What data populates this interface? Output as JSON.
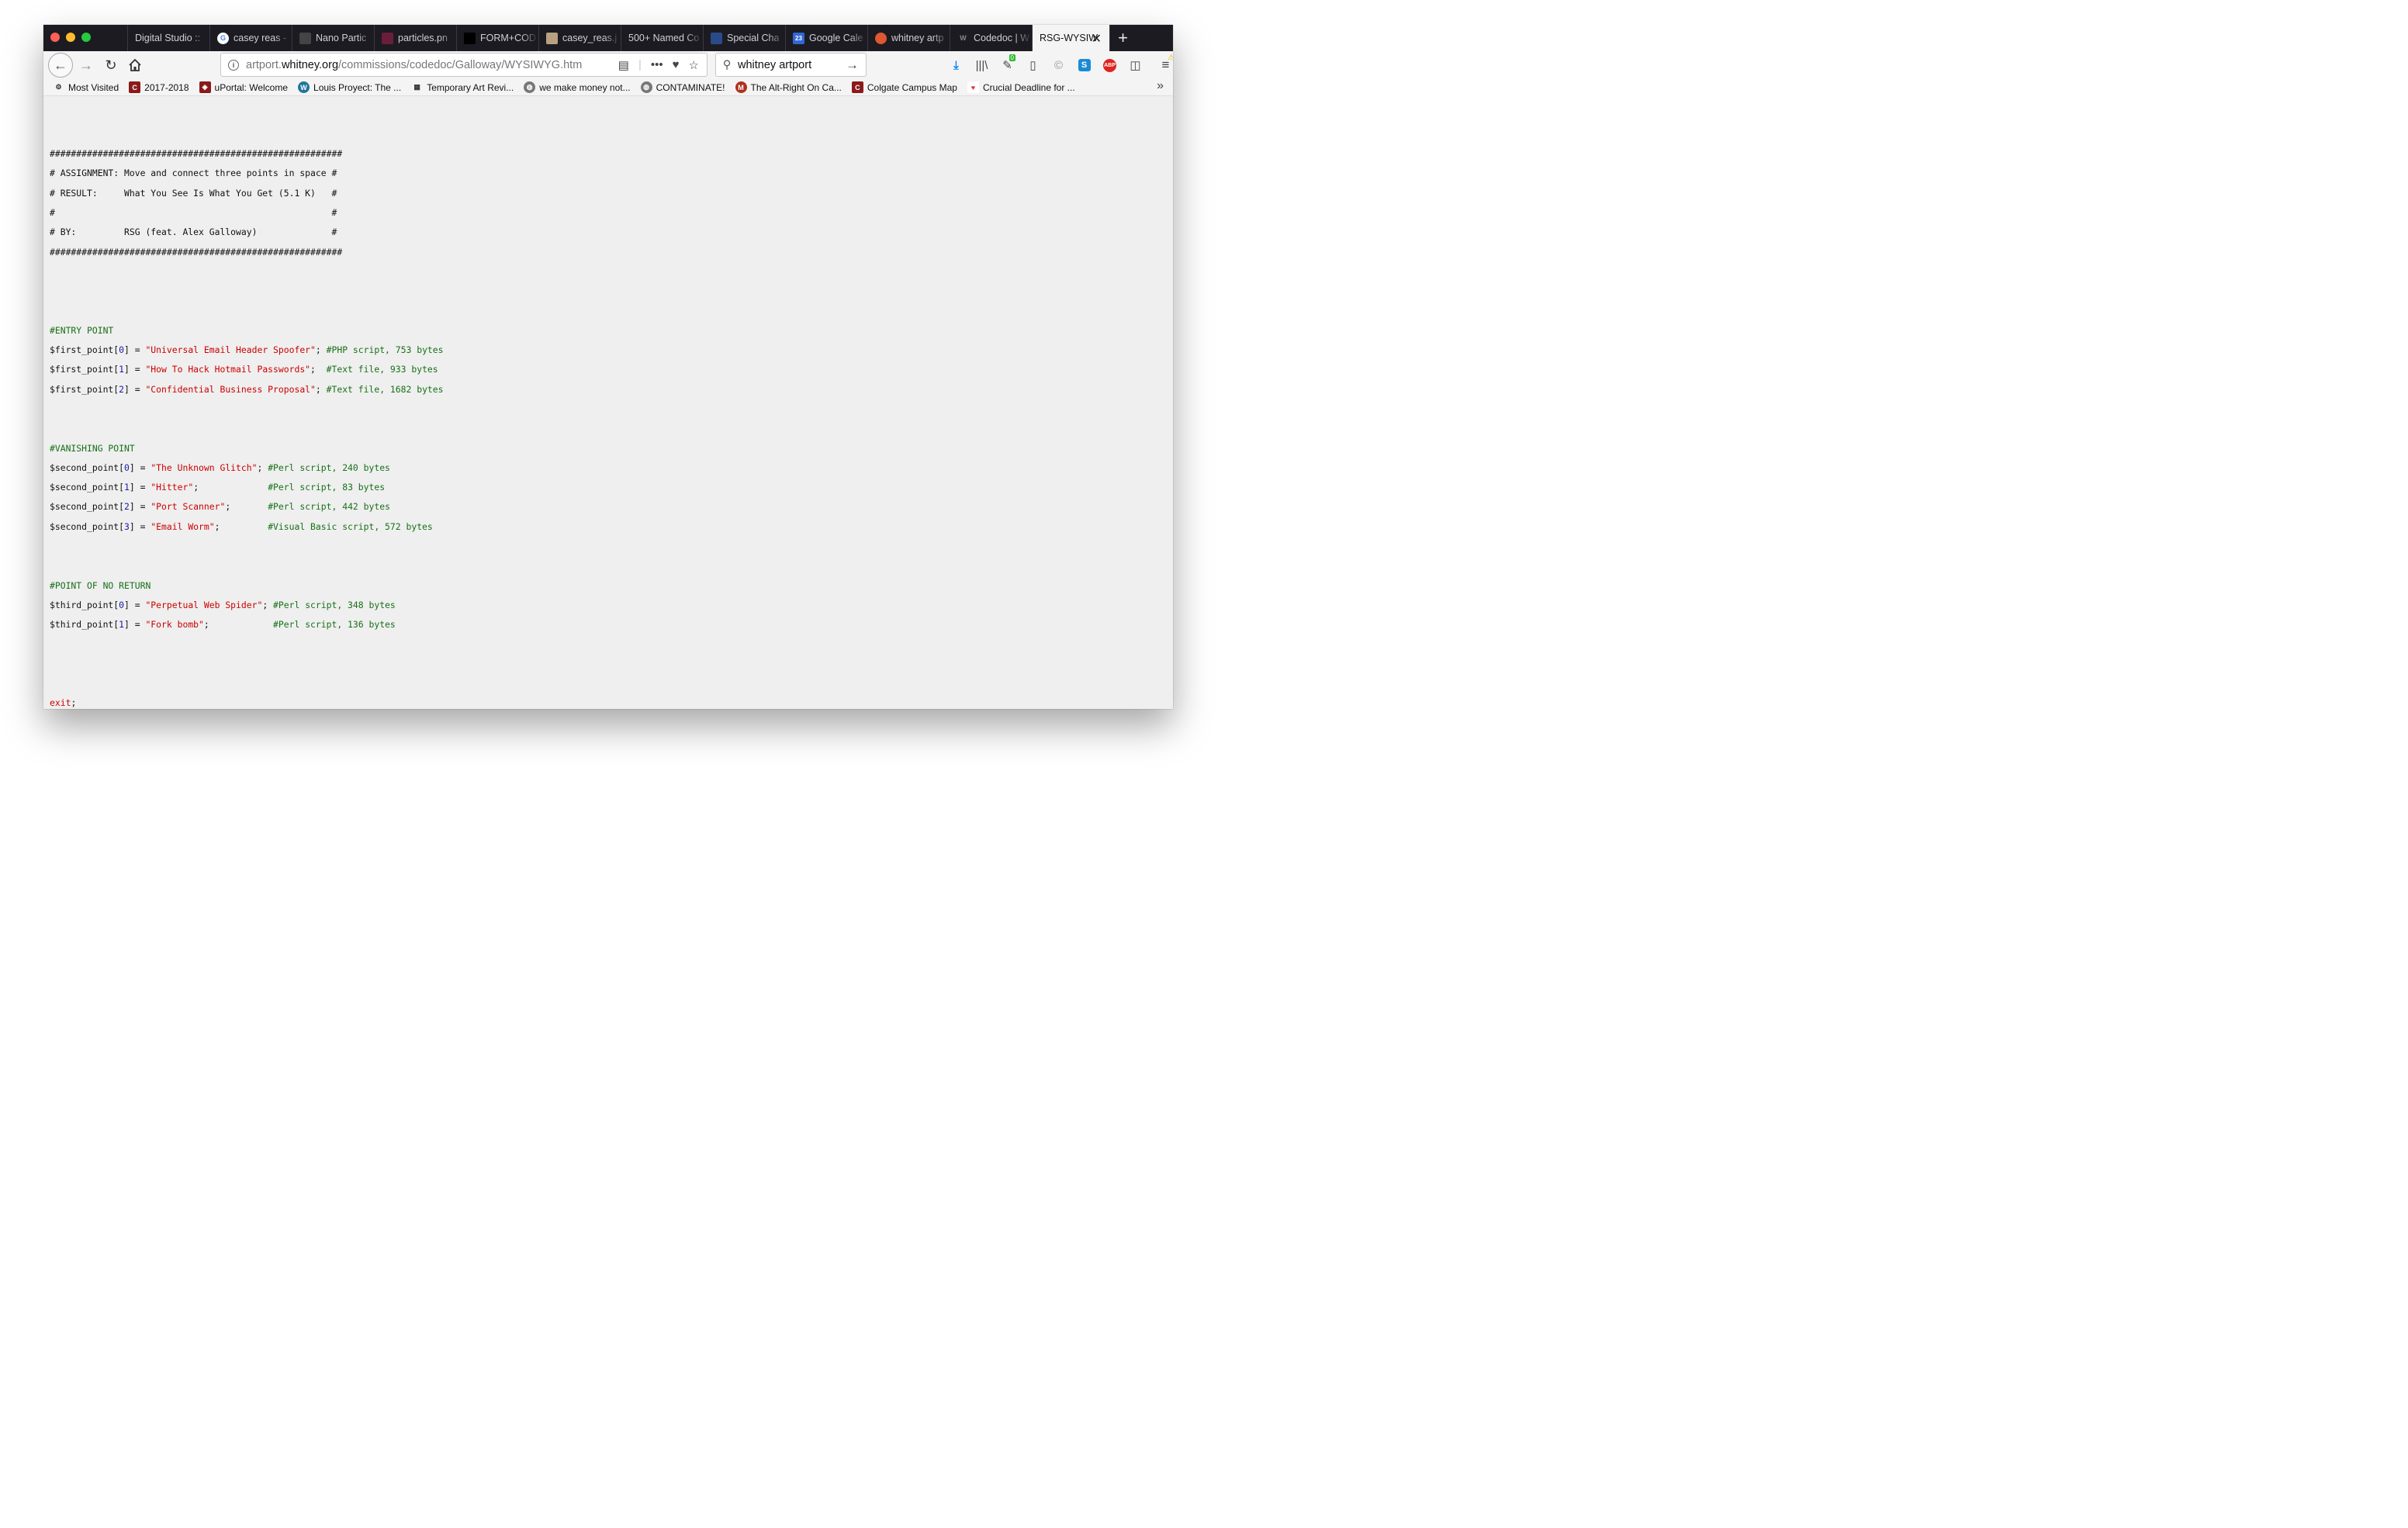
{
  "browser": {
    "tabs": [
      {
        "title": "Digital Studio ::",
        "icon": "blank-icon",
        "color": "#1c1b22"
      },
      {
        "title": "casey reas -",
        "icon": "google-icon",
        "color": "#ffffff"
      },
      {
        "title": "Nano Partic",
        "icon": "image-icon",
        "color": "#444444"
      },
      {
        "title": "particles.pn",
        "icon": "image-icon",
        "color": "#6a1e3a"
      },
      {
        "title": "FORM+COD",
        "icon": "book-icon",
        "color": "#000000"
      },
      {
        "title": "casey_reas.j",
        "icon": "image-icon",
        "color": "#b8a080"
      },
      {
        "title": "500+ Named Co",
        "icon": "blank-icon",
        "color": "#1c1b22"
      },
      {
        "title": "Special Cha",
        "icon": "page-icon",
        "color": "#2a4a8a"
      },
      {
        "title": "Google Cale",
        "icon": "calendar-icon",
        "color": "#3367d6"
      },
      {
        "title": "whitney artp",
        "icon": "duckduckgo-icon",
        "color": "#de5833"
      },
      {
        "title": "Codedoc | W",
        "icon": "whitney-icon",
        "color": "#1c1b22"
      },
      {
        "title": "RSG-WYSIW",
        "icon": "blank-icon",
        "color": "#f4f4f4",
        "active": true
      }
    ],
    "new_tab_label": "+",
    "close_tab_label": "✕",
    "url_prefix": "artport.",
    "url_domain": "whitney.org",
    "url_path": "/commissions/codedoc/Galloway/WYSIWYG.htm",
    "search_value": "whitney artport",
    "extension_badge": "0",
    "bookmarks": [
      {
        "label": "Most Visited",
        "icon": "gear-icon",
        "color": "#f4f4f4"
      },
      {
        "label": "2017-2018",
        "icon": "c-icon",
        "color": "#8b1a1a"
      },
      {
        "label": "uPortal: Welcome",
        "icon": "shield-icon",
        "color": "#8b1a1a"
      },
      {
        "label": "Louis Proyect: The ...",
        "icon": "wordpress-icon",
        "color": "#21759b"
      },
      {
        "label": "Temporary Art Revi...",
        "icon": "grid-icon",
        "color": "#f4f4f4"
      },
      {
        "label": "we make money not...",
        "icon": "globe-icon",
        "color": "#777777"
      },
      {
        "label": "CONTAMINATE!",
        "icon": "globe-icon",
        "color": "#777777"
      },
      {
        "label": "The Alt-Right On Ca...",
        "icon": "mj-icon",
        "color": "#b03020"
      },
      {
        "label": "Colgate Campus Map",
        "icon": "c-icon",
        "color": "#8b1a1a"
      },
      {
        "label": "Crucial Deadline for ...",
        "icon": "heart-icon",
        "color": "#ffffff"
      }
    ]
  },
  "code": {
    "header": [
      "#######################################################",
      "# ASSIGNMENT: Move and connect three points in space #",
      "# RESULT:     What You See Is What You Get (5.1 K)   #",
      "#                                                    #",
      "# BY:         RSG (feat. Alex Galloway)              #",
      "#######################################################"
    ],
    "sections": [
      {
        "title": "#ENTRY POINT",
        "lines": [
          {
            "var": "$first_point[",
            "idx": "0",
            "close": "] = ",
            "str": "\"Universal Email Header Spoofer\"",
            "sep": "; ",
            "comment": "#PHP script, 753 bytes"
          },
          {
            "var": "$first_point[",
            "idx": "1",
            "close": "] = ",
            "str": "\"How To Hack Hotmail Passwords\"",
            "sep": ";  ",
            "comment": "#Text file, 933 bytes"
          },
          {
            "var": "$first_point[",
            "idx": "2",
            "close": "] = ",
            "str": "\"Confidential Business Proposal\"",
            "sep": "; ",
            "comment": "#Text file, 1682 bytes"
          }
        ]
      },
      {
        "title": "#VANISHING POINT",
        "lines": [
          {
            "var": "$second_point[",
            "idx": "0",
            "close": "] = ",
            "str": "\"The Unknown Glitch\"",
            "sep": "; ",
            "comment": "#Perl script, 240 bytes"
          },
          {
            "var": "$second_point[",
            "idx": "1",
            "close": "] = ",
            "str": "\"Hitter\"",
            "sep": ";             ",
            "comment": "#Perl script, 83 bytes"
          },
          {
            "var": "$second_point[",
            "idx": "2",
            "close": "] = ",
            "str": "\"Port Scanner\"",
            "sep": ";       ",
            "comment": "#Perl script, 442 bytes"
          },
          {
            "var": "$second_point[",
            "idx": "3",
            "close": "] = ",
            "str": "\"Email Worm\"",
            "sep": ";         ",
            "comment": "#Visual Basic script, 572 bytes"
          }
        ]
      },
      {
        "title": "#POINT OF NO RETURN",
        "lines": [
          {
            "var": "$third_point[",
            "idx": "0",
            "close": "] = ",
            "str": "\"Perpetual Web Spider\"",
            "sep": "; ",
            "comment": "#Perl script, 348 bytes"
          },
          {
            "var": "$third_point[",
            "idx": "1",
            "close": "] = ",
            "str": "\"Fork bomb\"",
            "sep": ";            ",
            "comment": "#Perl script, 136 bytes"
          }
        ]
      }
    ],
    "exit_keyword": "exit",
    "exit_semicolon": ";"
  }
}
